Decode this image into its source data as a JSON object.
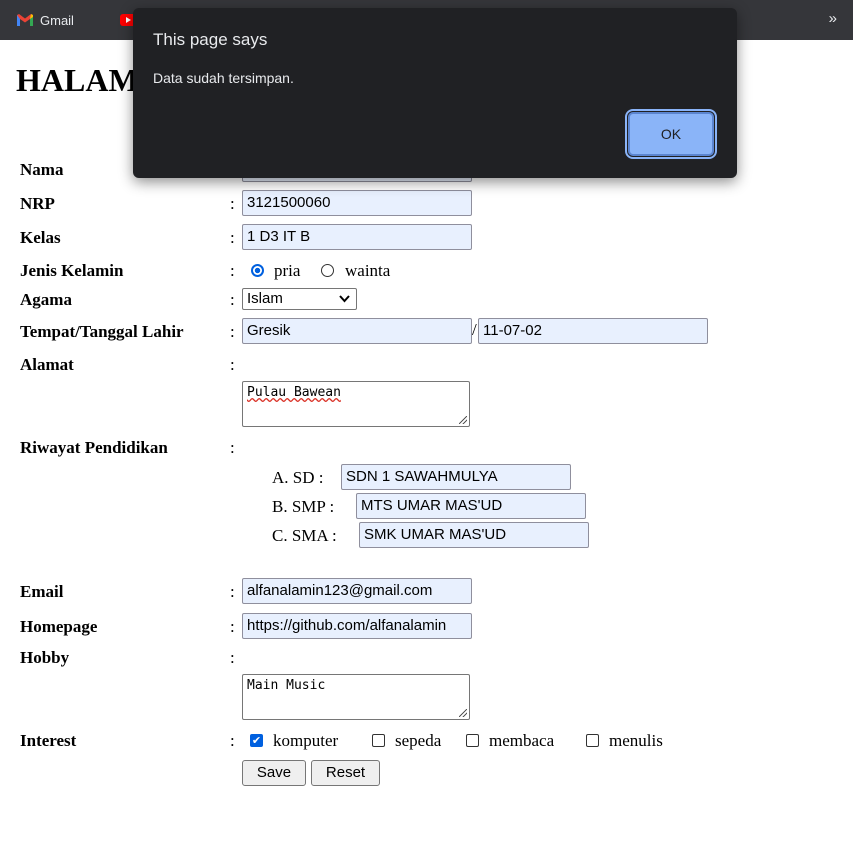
{
  "bookmarks": {
    "items": [
      {
        "label": "Gmail",
        "icon": "gmail-icon"
      },
      {
        "label": "",
        "icon": "youtube-icon"
      }
    ],
    "overflow": "»"
  },
  "page": {
    "heading": "HALAM"
  },
  "form": {
    "colon": ":",
    "nama": {
      "label": "Nama",
      "value": ""
    },
    "nrp": {
      "label": "NRP",
      "value": "3121500060"
    },
    "kelas": {
      "label": "Kelas",
      "value": "1 D3 IT B"
    },
    "jenis_kelamin": {
      "label": "Jenis Kelamin",
      "options": [
        "pria",
        "wainta"
      ],
      "selected": "pria"
    },
    "agama": {
      "label": "Agama",
      "value": "Islam"
    },
    "ttl": {
      "label": "Tempat/Tanggal Lahir",
      "tempat": "Gresik",
      "separator": "/",
      "tanggal": "11-07-02"
    },
    "alamat": {
      "label": "Alamat",
      "value": "Pulau Bawean"
    },
    "riwayat": {
      "label": "Riwayat Pendidikan",
      "sd": {
        "label": "A. SD :",
        "value": "SDN 1 SAWAHMULYA"
      },
      "smp": {
        "label": "B. SMP :",
        "value": "MTS UMAR MAS'UD"
      },
      "sma": {
        "label": "C. SMA :",
        "value": "SMK UMAR MAS'UD"
      }
    },
    "email": {
      "label": "Email",
      "value": "alfanalamin123@gmail.com"
    },
    "homepage": {
      "label": "Homepage",
      "value": "https://github.com/alfanalamin"
    },
    "hobby": {
      "label": "Hobby",
      "value": "Main Music"
    },
    "interest": {
      "label": "Interest",
      "options": [
        {
          "label": "komputer",
          "checked": true
        },
        {
          "label": "sepeda",
          "checked": false
        },
        {
          "label": "membaca",
          "checked": false
        },
        {
          "label": "menulis",
          "checked": false
        }
      ]
    },
    "save_label": "Save",
    "reset_label": "Reset"
  },
  "dialog": {
    "title": "This page says",
    "message": "Data sudah tersimpan.",
    "ok_label": "OK"
  },
  "colors": {
    "autofill_bg": "#e8f0fe",
    "accent": "#0060df",
    "dialog_bg": "#202124",
    "ok_button": "#8ab4f8"
  }
}
